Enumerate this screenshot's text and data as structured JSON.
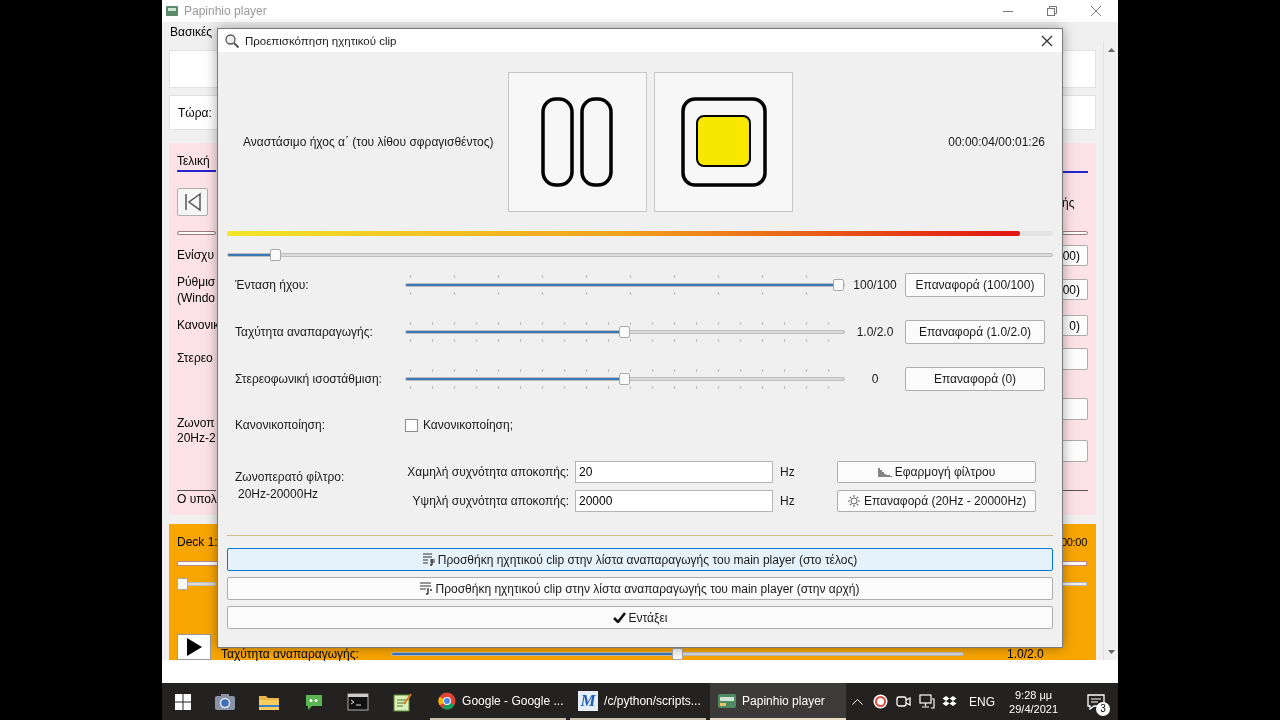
{
  "main_window": {
    "title": "Papinhio player",
    "menu": [
      "Βασικές"
    ],
    "now_label": "Τώρα:",
    "tab": "Τελική",
    "left_labels": [
      "Ενίσχυ",
      "Ρύθμισ",
      "(Windo",
      "Κανονικ",
      "Στερεο",
      "Ζωνοπ",
      "20Hz-2"
    ],
    "footer_text": "Ο υπολ",
    "right_text": "ής",
    "right_buttons": [
      "00)",
      "00)",
      "0)"
    ],
    "deck": {
      "title": "Deck 1:",
      "time": "00:00",
      "position": {
        "level": 0
      },
      "speed": {
        "label": "Ταχύτητα αναπαραγωγής:",
        "level": 0.5,
        "reading": "1.0/2.0"
      }
    }
  },
  "dialog": {
    "title": "Προεπισκόπηση ηχητικού clip",
    "clip_name": "Αναστάσιμο ήχος α΄ (του λίθου σφραγισθέντος)",
    "time": "00:00:04/00:01:26",
    "peak_meter": {
      "level": 0.96
    },
    "position": {
      "level": 0.053
    },
    "sliders": [
      {
        "label": "Ένταση ήχου:",
        "level": 1.0,
        "reading": "100/100",
        "reset": "Επαναφορά (100/100)"
      },
      {
        "label": "Ταχύτητα αναπαραγωγής:",
        "level": 0.5,
        "reading": "1.0/2.0",
        "reset": "Επαναφορά (1.0/2.0)"
      },
      {
        "label": "Στερεοφωνική ισοστάθμιση:",
        "level": 0.5,
        "reading": "0",
        "reset": "Επαναφορά (0)"
      }
    ],
    "normalization": {
      "label": "Κανονικοποίηση:",
      "checkbox_label": "Κανονικοποίηση;",
      "checked": false
    },
    "filter": {
      "label": "Ζωνοπερατό φίλτρο:",
      "range": "20Hz-20000Hz",
      "fields": [
        {
          "label": "Χαμηλή συχνότητα αποκοπής:",
          "value": "20",
          "unit": "Hz"
        },
        {
          "label": "Υψηλή συχνότητα αποκοπής:",
          "value": "20000",
          "unit": "Hz"
        }
      ],
      "apply": "Εφαρμογή φίλτρου",
      "reset": "Επαναφορά (20Hz - 20000Hz)"
    },
    "actions": [
      {
        "label": "Προσθήκη ηχητικού clip στην λίστα αναπαραγωγής του main player (στο τέλος)",
        "hovered": true
      },
      {
        "label": "Προσθήκη ηχητικού clip στην λίστα αναπαραγωγής του main player (στην αρχή)",
        "hovered": false
      }
    ],
    "ok": "Εντάξει"
  },
  "taskbar": {
    "apps": [
      {
        "kind": "browser",
        "label": "Google - Google ...",
        "selected": false
      },
      {
        "kind": "editor",
        "logo_text": "M",
        "label": "/c/python/scripts...",
        "selected": false
      },
      {
        "kind": "player",
        "label": "Papinhio player",
        "selected": true
      }
    ],
    "language": "ENG",
    "time": "9:28 μμ",
    "date": "29/4/2021",
    "notification_count": "3"
  }
}
